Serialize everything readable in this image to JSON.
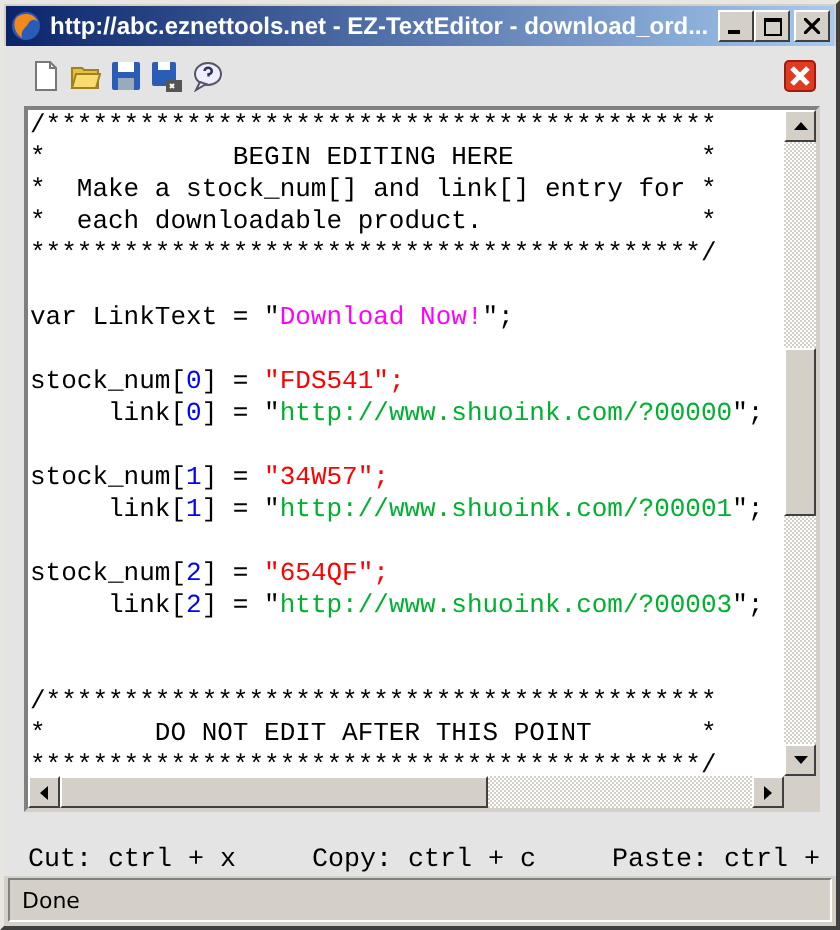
{
  "window": {
    "title": "http://abc.eznettools.net - EZ-TextEditor - download_ord..."
  },
  "toolbar": {
    "buttons": [
      {
        "kind": "new"
      },
      {
        "kind": "open"
      },
      {
        "kind": "save"
      },
      {
        "kind": "save-as"
      },
      {
        "kind": "help"
      }
    ]
  },
  "editor": {
    "lines": [
      {
        "kind": "code",
        "segments": [
          {
            "kind": "plain",
            "text": "/*******************************************"
          }
        ]
      },
      {
        "kind": "code",
        "segments": [
          {
            "kind": "plain",
            "text": "*            BEGIN EDITING HERE            *"
          }
        ]
      },
      {
        "kind": "code",
        "segments": [
          {
            "kind": "plain",
            "text": "*  Make a stock_num[] and link[] entry for *"
          }
        ]
      },
      {
        "kind": "code",
        "segments": [
          {
            "kind": "plain",
            "text": "*  each downloadable product.              *"
          }
        ]
      },
      {
        "kind": "code",
        "segments": [
          {
            "kind": "plain",
            "text": "*******************************************/"
          }
        ]
      },
      {
        "kind": "blank"
      },
      {
        "kind": "code",
        "segments": [
          {
            "kind": "plain",
            "text": "var LinkText = \""
          },
          {
            "kind": "label",
            "text": "Download Now!"
          },
          {
            "kind": "plain",
            "text": "\";"
          }
        ]
      },
      {
        "kind": "blank"
      },
      {
        "kind": "code",
        "segments": [
          {
            "kind": "plain",
            "text": "stock_num["
          },
          {
            "kind": "index",
            "text": "0"
          },
          {
            "kind": "plain",
            "text": "] = "
          },
          {
            "kind": "stock",
            "text": "\"FDS541\";"
          }
        ]
      },
      {
        "kind": "code",
        "segments": [
          {
            "kind": "plain",
            "text": "     link["
          },
          {
            "kind": "index",
            "text": "0"
          },
          {
            "kind": "plain",
            "text": "] = \""
          },
          {
            "kind": "url",
            "text": "http://www.shuoink.com/?00000"
          },
          {
            "kind": "plain",
            "text": "\";"
          }
        ]
      },
      {
        "kind": "blank"
      },
      {
        "kind": "code",
        "segments": [
          {
            "kind": "plain",
            "text": "stock_num["
          },
          {
            "kind": "index",
            "text": "1"
          },
          {
            "kind": "plain",
            "text": "] = "
          },
          {
            "kind": "stock",
            "text": "\"34W57\";"
          }
        ]
      },
      {
        "kind": "code",
        "segments": [
          {
            "kind": "plain",
            "text": "     link["
          },
          {
            "kind": "index",
            "text": "1"
          },
          {
            "kind": "plain",
            "text": "] = \""
          },
          {
            "kind": "url",
            "text": "http://www.shuoink.com/?00001"
          },
          {
            "kind": "plain",
            "text": "\";"
          }
        ]
      },
      {
        "kind": "blank"
      },
      {
        "kind": "code",
        "segments": [
          {
            "kind": "plain",
            "text": "stock_num["
          },
          {
            "kind": "index",
            "text": "2"
          },
          {
            "kind": "plain",
            "text": "] = "
          },
          {
            "kind": "stock",
            "text": "\"654QF\";"
          }
        ]
      },
      {
        "kind": "code",
        "segments": [
          {
            "kind": "plain",
            "text": "     link["
          },
          {
            "kind": "index",
            "text": "2"
          },
          {
            "kind": "plain",
            "text": "] = \""
          },
          {
            "kind": "url",
            "text": "http://www.shuoink.com/?00003"
          },
          {
            "kind": "plain",
            "text": "\";"
          }
        ]
      },
      {
        "kind": "blank"
      },
      {
        "kind": "blank"
      },
      {
        "kind": "code",
        "segments": [
          {
            "kind": "plain",
            "text": "/*******************************************"
          }
        ]
      },
      {
        "kind": "code",
        "segments": [
          {
            "kind": "plain",
            "text": "*       DO NOT EDIT AFTER THIS POINT       *"
          }
        ]
      },
      {
        "kind": "code",
        "segments": [
          {
            "kind": "plain",
            "text": "*******************************************/"
          }
        ]
      }
    ]
  },
  "shortcuts": [
    "Cut: ctrl + x",
    "Copy: ctrl + c",
    "Paste: ctrl +"
  ],
  "status_bar": "Done"
}
